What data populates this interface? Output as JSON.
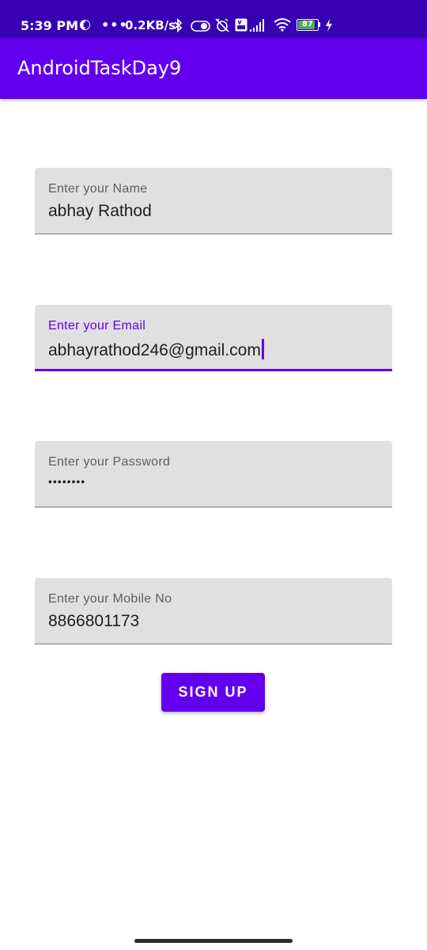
{
  "status_bar": {
    "time": "5:39 PM",
    "dots": "•••",
    "network_speed": "0.2KB/s",
    "battery_level": "87",
    "battery_fraction": 0.87,
    "icons": [
      "network-activity-icon",
      "bluetooth-icon",
      "toggle-icon",
      "alarm-off-icon",
      "volte-icon",
      "signal-icon",
      "wifi-icon",
      "battery-icon",
      "charging-icon"
    ]
  },
  "app_bar": {
    "title": "AndroidTaskDay9",
    "color": "#6200EE",
    "status_color": "#3700B3"
  },
  "form": {
    "name": {
      "label": "Enter your Name",
      "value": "abhay Rathod"
    },
    "email": {
      "label": "Enter your Email",
      "value": "abhayrathod246@gmail.com",
      "focused": true
    },
    "password": {
      "label": "Enter your Password",
      "value": "••••••••"
    },
    "mobile": {
      "label": "Enter your Mobile No",
      "value": "8866801173"
    },
    "signup_label": "SIGN UP"
  },
  "colors": {
    "accent": "#6200EE",
    "field_background": "#e0e0e0"
  }
}
